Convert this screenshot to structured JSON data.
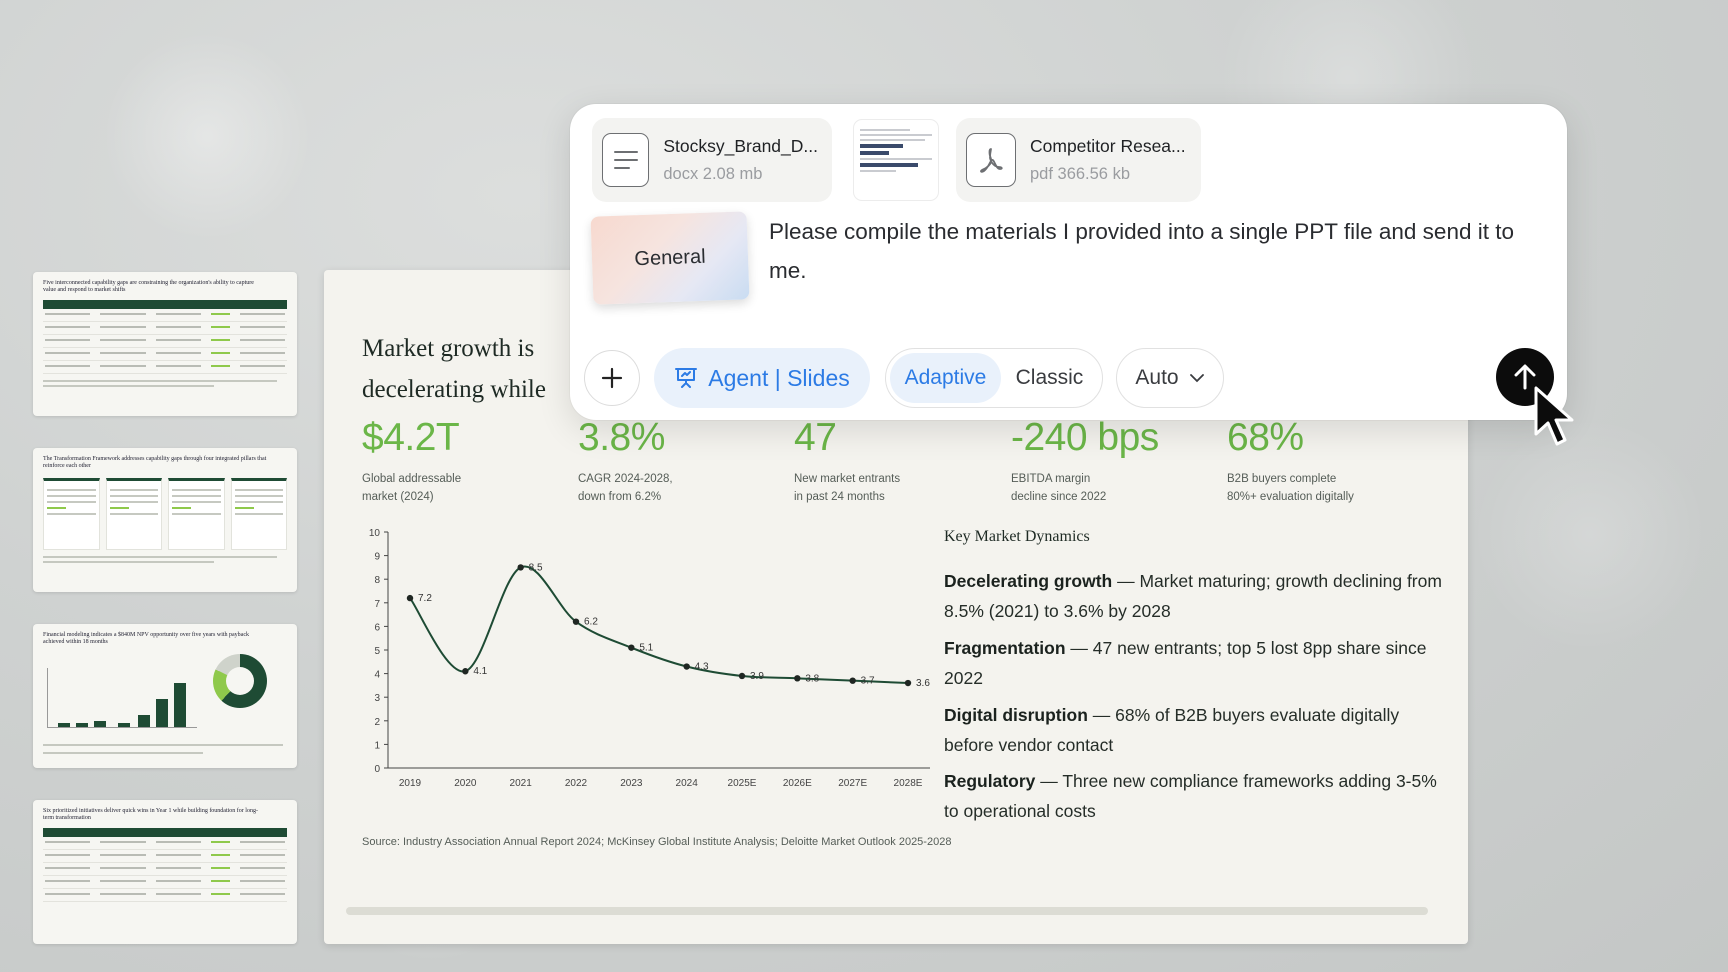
{
  "composer": {
    "attachments": [
      {
        "name": "Stocksy_Brand_D...",
        "meta": "docx 2.08 mb",
        "icon": "document-lines-icon"
      },
      {
        "name": "Competitor Resea...",
        "meta": "pdf 366.56 kb",
        "icon": "pdf-icon"
      }
    ],
    "image_attachment_icon": "image-thumbnail",
    "card_label": "General",
    "prompt": "Please compile the materials I provided into a single PPT file and send it to me.",
    "agent_label": "Agent | Slides",
    "modes": [
      "Adaptive",
      "Classic"
    ],
    "active_mode": "Adaptive",
    "auto_label": "Auto",
    "accent_color": "#2c7be5"
  },
  "slide": {
    "title": "Market growth is decelerating while margins across the",
    "kpis": [
      {
        "value": "$4.2T",
        "label": "Global addressable\nmarket (2024)"
      },
      {
        "value": "3.8%",
        "label": "CAGR 2024-2028,\ndown from 6.2%"
      },
      {
        "value": "47",
        "label": "New market entrants\nin past 24 months"
      },
      {
        "value": "-240 bps",
        "label": "EBITDA margin\ndecline since 2022"
      },
      {
        "value": "68%",
        "label": "B2B buyers complete\n80%+ evaluation digitally"
      }
    ],
    "dynamics_heading": "Key Market Dynamics",
    "dynamics": [
      {
        "term": "Decelerating growth",
        "text": " — Market maturing; growth declining from 8.5% (2021) to 3.6% by 2028"
      },
      {
        "term": "Fragmentation",
        "text": " — 47 new entrants; top 5 lost 8pp share since 2022"
      },
      {
        "term": "Digital disruption",
        "text": " — 68% of B2B buyers evaluate digitally before vendor contact"
      },
      {
        "term": "Regulatory",
        "text": " — Three new compliance frameworks adding 3-5% to operational costs"
      }
    ],
    "source": "Source: Industry Association Annual Report 2024; McKinsey Global Institute Analysis; Deloitte Market Outlook 2025-2028",
    "kpi_color": "#6bb648"
  },
  "thumbnails": [
    {
      "title": "Five interconnected capability gaps are constraining the organization's ability to capture value and respond to market shifts"
    },
    {
      "title": "The Transformation Framework addresses capability gaps through four integrated pillars that reinforce each other"
    },
    {
      "title": "Financial modeling indicates a $840M NPV opportunity over five years with payback achieved within 18 months"
    },
    {
      "title": "Six prioritized initiatives deliver quick wins in Year 1 while building foundation for long-term transformation"
    }
  ],
  "chart_data": {
    "type": "line",
    "x": [
      "2019",
      "2020",
      "2021",
      "2022",
      "2023",
      "2024",
      "2025E",
      "2026E",
      "2027E",
      "2028E"
    ],
    "series": [
      {
        "values": [
          7.2,
          4.1,
          8.5,
          6.2,
          5.1,
          4.3,
          3.9,
          3.8,
          3.7,
          3.6
        ]
      }
    ],
    "ylim": [
      0,
      10
    ],
    "yticks": [
      0,
      1,
      2,
      3,
      4,
      5,
      6,
      7,
      8,
      9,
      10
    ],
    "grid": false,
    "line_color": "#1e4b34",
    "smooth": true
  }
}
